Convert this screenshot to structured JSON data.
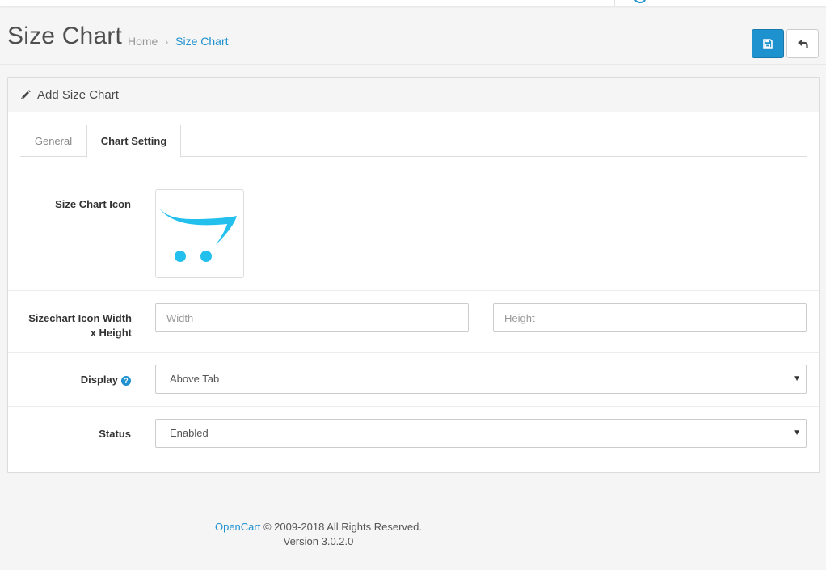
{
  "header": {
    "title": "Size Chart",
    "breadcrumb": [
      {
        "label": "Home"
      },
      {
        "label": "Size Chart"
      }
    ],
    "save_icon": "save-icon",
    "back_icon": "reply-icon"
  },
  "panel": {
    "title": "Add Size Chart",
    "title_icon": "pencil-icon",
    "tabs": [
      {
        "label": "General",
        "active": false
      },
      {
        "label": "Chart Setting",
        "active": true
      }
    ]
  },
  "form": {
    "icon_label": "Size Chart Icon",
    "icon_image": "opencart-logo-icon",
    "size_label_line1": "Sizechart Icon Width",
    "size_label_line2": "x Height",
    "width_placeholder": "Width",
    "height_placeholder": "Height",
    "display_label": "Display",
    "display_help": "?",
    "display_value": "Above Tab",
    "status_label": "Status",
    "status_value": "Enabled"
  },
  "footer": {
    "brand": "OpenCart",
    "copyright": "© 2009-2018 All Rights Reserved.",
    "version": "Version 3.0.2.0"
  },
  "colors": {
    "accent": "#1e91cf",
    "logo": "#23c0ee"
  }
}
